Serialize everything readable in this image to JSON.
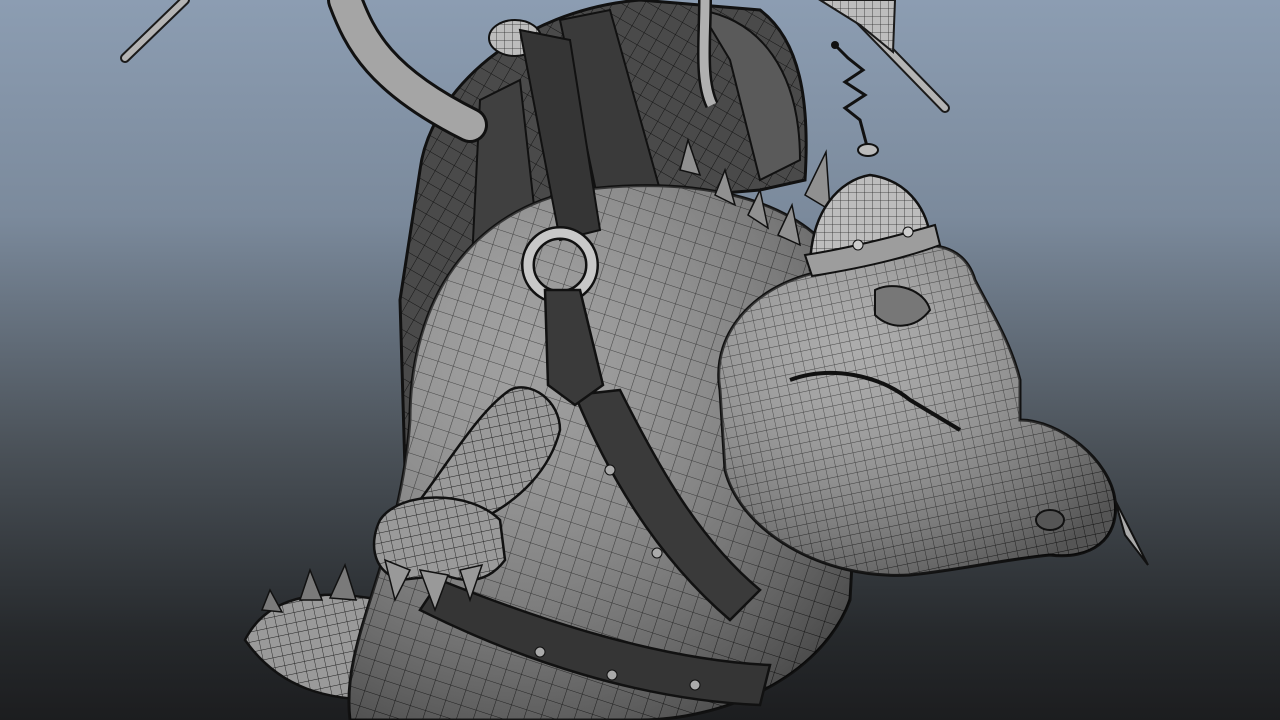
{
  "viewport": {
    "view": "perspective",
    "display_mode": "wireframe-on-shaded",
    "background_top": "#8c9db2",
    "background_bottom": "#1c1d1f"
  },
  "scene": {
    "subject": "crocodile-character-model",
    "mesh_color": "#1a1a1a",
    "surface_color": "#8a8a8a",
    "icons": {
      "wand": "weapon-axe-icon",
      "antenna": "spring-antenna-icon"
    }
  }
}
